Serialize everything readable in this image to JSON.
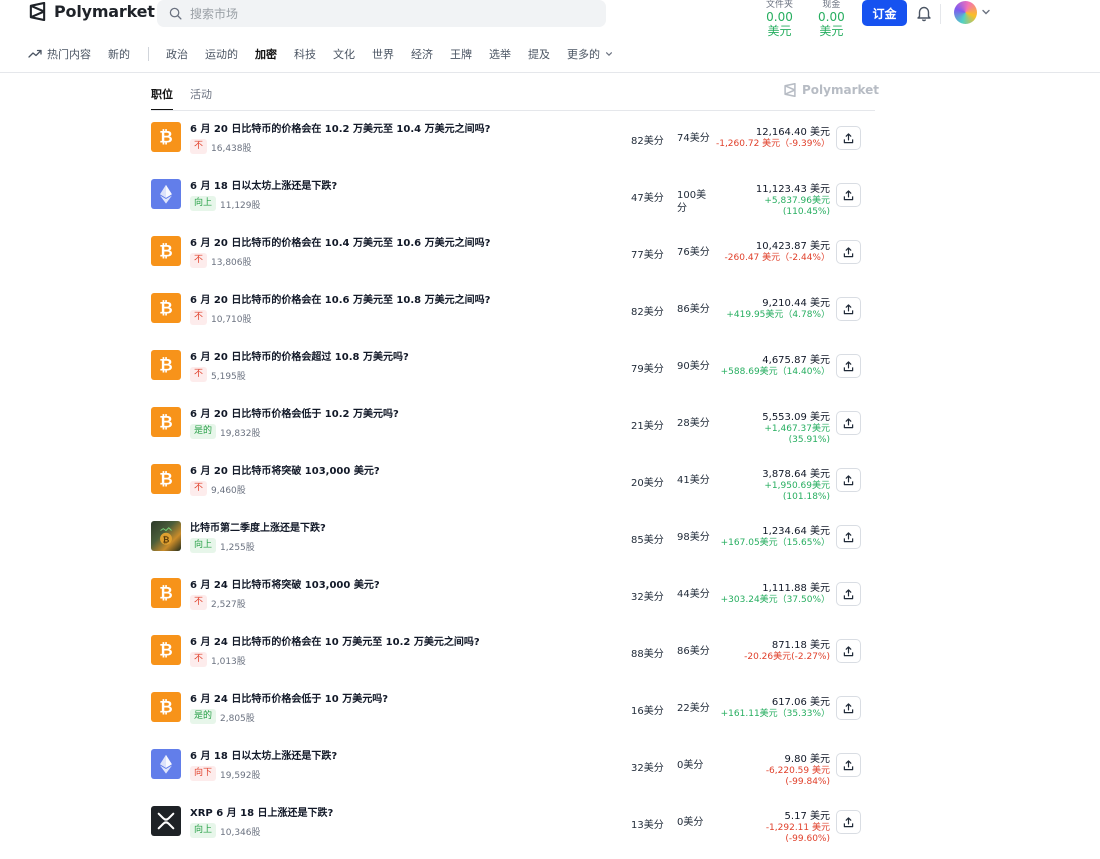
{
  "header": {
    "logo_text": "Polymarket",
    "search_placeholder": "搜索市场",
    "portfolio": {
      "label": "文件夹",
      "amount": "0.00",
      "currency": "美元"
    },
    "cash": {
      "label": "现金",
      "amount": "0.00",
      "currency": "美元"
    },
    "deposit_label": "订金",
    "accent_color": "#1652f0"
  },
  "nav": {
    "trending": "热门内容",
    "new": "新的",
    "categories": [
      "政治",
      "运动的",
      "加密",
      "科技",
      "文化",
      "世界",
      "经济",
      "王牌",
      "选举",
      "提及"
    ],
    "active_category": "加密",
    "more": "更多的"
  },
  "tabs": {
    "positions": "职位",
    "activity": "活动"
  },
  "watermark": "Polymarket",
  "positions": [
    {
      "icon": "bitcoin-icon",
      "title": "6 月 20 日比特币的价格会在 10.2 万美元至 10.4 万美元之间吗?",
      "outcome": "不",
      "outcome_color": "red",
      "shares": "16,438股",
      "avg": "82美分",
      "current": "74美分",
      "value": "12,164.40 美元",
      "change1": "-1,260.72 美元（-9.39%）",
      "change2": "",
      "change_sign": "neg"
    },
    {
      "icon": "ethereum-icon",
      "title": "6 月 18 日以太坊上涨还是下跌?",
      "outcome": "向上",
      "outcome_color": "green",
      "shares": "11,129股",
      "avg": "47美分",
      "current": "100美分",
      "value": "11,123.43 美元",
      "change1": "+5,837.96美元",
      "change2": "(110.45%)",
      "change_sign": "pos"
    },
    {
      "icon": "bitcoin-icon",
      "title": "6 月 20 日比特币的价格会在 10.4 万美元至 10.6 万美元之间吗?",
      "outcome": "不",
      "outcome_color": "red",
      "shares": "13,806股",
      "avg": "77美分",
      "current": "76美分",
      "value": "10,423.87 美元",
      "change1": "-260.47 美元（-2.44%）",
      "change2": "",
      "change_sign": "neg"
    },
    {
      "icon": "bitcoin-icon",
      "title": "6 月 20 日比特币的价格会在 10.6 万美元至 10.8 万美元之间吗?",
      "outcome": "不",
      "outcome_color": "red",
      "shares": "10,710股",
      "avg": "82美分",
      "current": "86美分",
      "value": "9,210.44 美元",
      "change1": "+419.95美元（4.78%）",
      "change2": "",
      "change_sign": "pos"
    },
    {
      "icon": "bitcoin-icon",
      "title": "6 月 20 日比特币的价格会超过 10.8 万美元吗?",
      "outcome": "不",
      "outcome_color": "red",
      "shares": "5,195股",
      "avg": "79美分",
      "current": "90美分",
      "value": "4,675.87 美元",
      "change1": "+588.69美元（14.40%）",
      "change2": "",
      "change_sign": "pos"
    },
    {
      "icon": "bitcoin-icon",
      "title": "6 月 20 日比特币价格会低于 10.2 万美元吗?",
      "outcome": "是的",
      "outcome_color": "green",
      "shares": "19,832股",
      "avg": "21美分",
      "current": "28美分",
      "value": "5,553.09 美元",
      "change1": "+1,467.37美元",
      "change2": "(35.91%)",
      "change_sign": "pos"
    },
    {
      "icon": "bitcoin-icon",
      "title": "6 月 20 日比特币将突破 103,000 美元?",
      "outcome": "不",
      "outcome_color": "red",
      "shares": "9,460股",
      "avg": "20美分",
      "current": "41美分",
      "value": "3,878.64 美元",
      "change1": "+1,950.69美元",
      "change2": "(101.18%)",
      "change_sign": "pos"
    },
    {
      "icon": "bitcoin-photo-icon",
      "title": "比特币第二季度上涨还是下跌?",
      "outcome": "向上",
      "outcome_color": "green",
      "shares": "1,255股",
      "avg": "85美分",
      "current": "98美分",
      "value": "1,234.64 美元",
      "change1": "+167.05美元（15.65%）",
      "change2": "",
      "change_sign": "pos"
    },
    {
      "icon": "bitcoin-icon",
      "title": "6 月 24 日比特币将突破 103,000 美元?",
      "outcome": "不",
      "outcome_color": "red",
      "shares": "2,527股",
      "avg": "32美分",
      "current": "44美分",
      "value": "1,111.88 美元",
      "change1": "+303.24美元（37.50%）",
      "change2": "",
      "change_sign": "pos"
    },
    {
      "icon": "bitcoin-icon",
      "title": "6 月 24 日比特币的价格会在 10 万美元至 10.2 万美元之间吗?",
      "outcome": "不",
      "outcome_color": "red",
      "shares": "1,013股",
      "avg": "88美分",
      "current": "86美分",
      "value": "871.18 美元",
      "change1": "-20.26美元(-2.27%)",
      "change2": "",
      "change_sign": "neg"
    },
    {
      "icon": "bitcoin-icon",
      "title": "6 月 24 日比特币价格会低于 10 万美元吗?",
      "outcome": "是的",
      "outcome_color": "green",
      "shares": "2,805股",
      "avg": "16美分",
      "current": "22美分",
      "value": "617.06 美元",
      "change1": "+161.11美元（35.33%）",
      "change2": "",
      "change_sign": "pos"
    },
    {
      "icon": "ethereum-icon",
      "title": "6 月 18 日以太坊上涨还是下跌?",
      "outcome": "向下",
      "outcome_color": "red",
      "shares": "19,592股",
      "avg": "32美分",
      "current": "0美分",
      "value": "9.80 美元",
      "change1": "-6,220.59 美元",
      "change2": "(-99.84%)",
      "change_sign": "neg"
    },
    {
      "icon": "xrp-icon",
      "title": "XRP 6 月 18 日上涨还是下跌?",
      "outcome": "向上",
      "outcome_color": "green",
      "shares": "10,346股",
      "avg": "13美分",
      "current": "0美分",
      "value": "5.17 美元",
      "change1": "-1,292.11 美元",
      "change2": "(-99.60%)",
      "change_sign": "neg"
    }
  ]
}
